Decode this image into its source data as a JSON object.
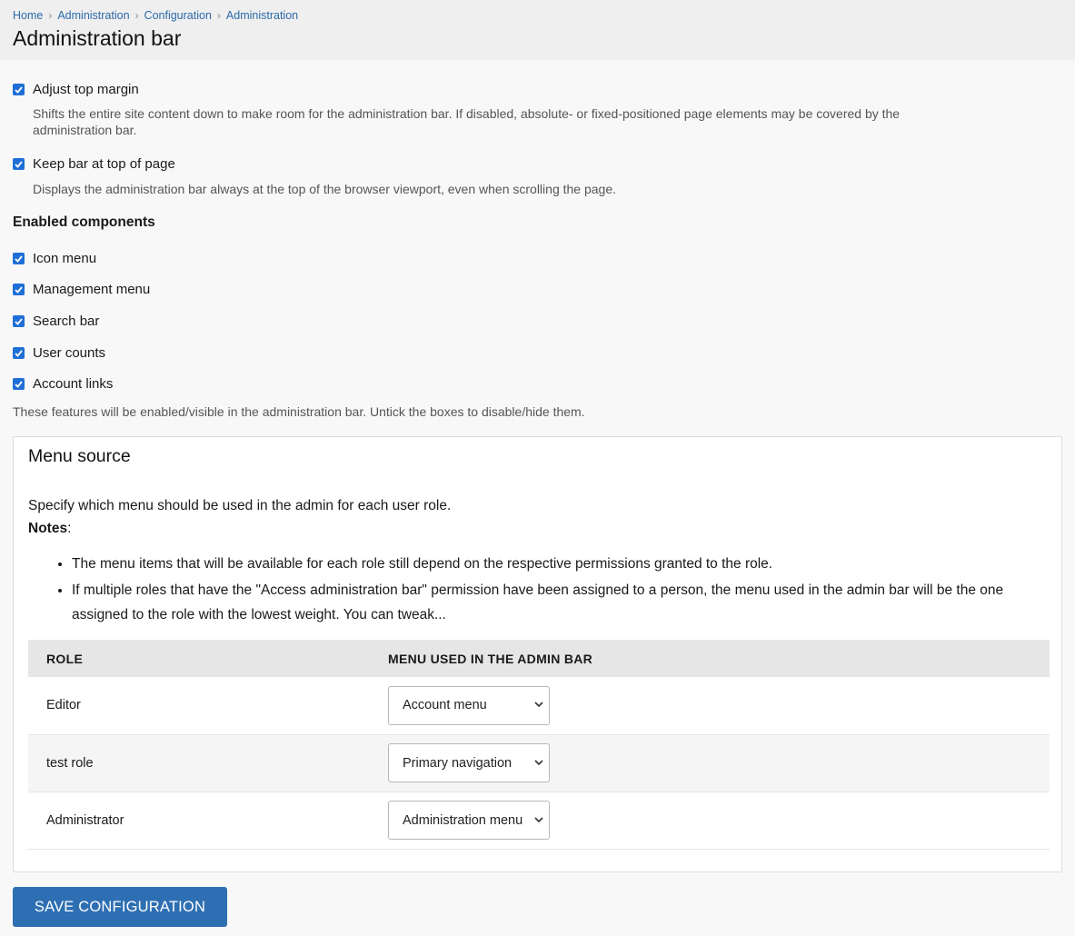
{
  "breadcrumb": [
    "Home",
    "Administration",
    "Configuration",
    "Administration"
  ],
  "page_title": "Administration bar",
  "options": [
    {
      "label": "Adjust top margin",
      "checked": true,
      "description_line1": "Shifts the entire site content down to make room for the administration bar. If disabled, absolute- or fixed-positioned page elements may be covered by the",
      "description_line2": "administration bar."
    },
    {
      "label": "Keep bar at top of page",
      "checked": true,
      "description": "Displays the administration bar always at the top of the browser viewport, even when scrolling the page."
    }
  ],
  "enabled_components": {
    "title": "Enabled components",
    "items": [
      {
        "label": "Icon menu",
        "checked": true
      },
      {
        "label": "Management menu",
        "checked": true
      },
      {
        "label": "Search bar",
        "checked": true
      },
      {
        "label": "User counts",
        "checked": true
      },
      {
        "label": "Account links",
        "checked": true
      }
    ],
    "help": "These features will be enabled/visible in the administration bar. Untick the boxes to disable/hide them."
  },
  "menu_source": {
    "legend": "Menu source",
    "intro": "Specify which menu should be used in the admin for each user role.",
    "notes_label": "Notes",
    "notes_colon": ":",
    "notes": [
      "The menu items that will be available for each role still depend on the respective permissions granted to the role.",
      "If multiple roles that have the \"Access administration bar\" permission have been assigned to a person, the menu used in the admin bar will be the one assigned to the role with the lowest weight. You can tweak..."
    ],
    "table": {
      "headers": [
        "ROLE",
        "MENU USED IN THE ADMIN BAR"
      ],
      "rows": [
        {
          "role": "Editor",
          "menu": "Account menu"
        },
        {
          "role": "test role",
          "menu": "Primary navigation"
        },
        {
          "role": "Administrator",
          "menu": "Administration menu"
        }
      ]
    }
  },
  "save_button": "SAVE CONFIGURATION",
  "colors": {
    "accent": "#2e6fb3",
    "checkbox": "#1f6fd6",
    "link": "#2b6aa8"
  }
}
